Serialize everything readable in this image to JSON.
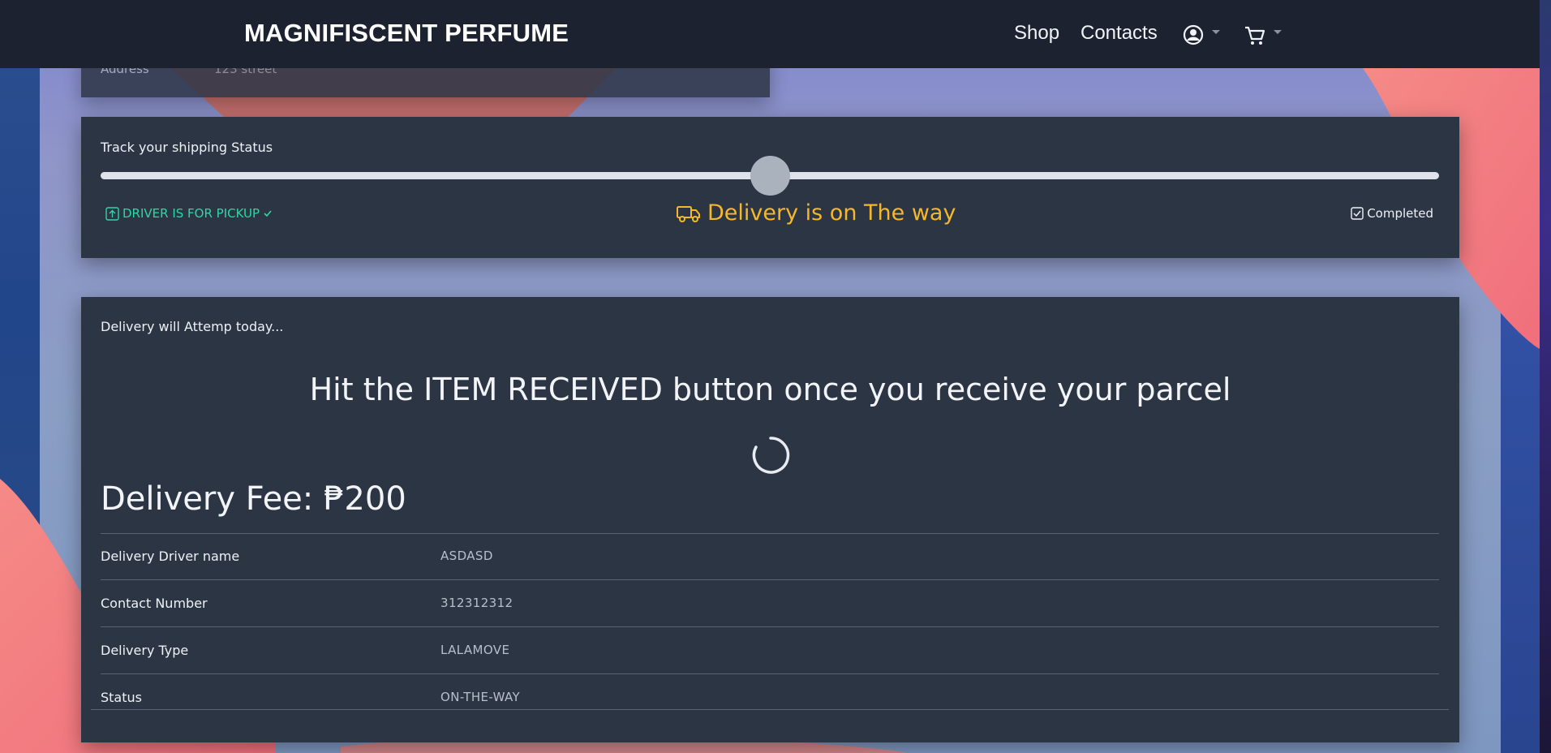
{
  "navbar": {
    "brand": "MAGNIFISCENT PERFUME",
    "links": {
      "shop": "Shop",
      "contacts": "Contacts"
    },
    "icons": [
      "user-circle-icon",
      "cart-icon"
    ]
  },
  "address": {
    "label": "Address",
    "value": "123 street"
  },
  "tracking": {
    "title": "Track your shipping Status",
    "progress_fraction": 0.5,
    "steps": {
      "pickup": "DRIVER IS FOR PICKUP",
      "on_the_way": "Delivery is on The way",
      "completed": "Completed"
    },
    "colors": {
      "pickup": "#30d6a3",
      "on_the_way": "#f5b82b"
    }
  },
  "delivery": {
    "attempt_text": "Delivery will Attemp today...",
    "instruction": "Hit the ITEM RECEIVED button once you receive your parcel",
    "fee": "Delivery Fee: ₱200",
    "rows": [
      {
        "label": "Delivery Driver name",
        "value": "ASDASD"
      },
      {
        "label": "Contact Number",
        "value": "312312312"
      },
      {
        "label": "Delivery Type",
        "value": "LALAMOVE"
      },
      {
        "label": "Status",
        "value": "ON-THE-WAY"
      }
    ]
  }
}
